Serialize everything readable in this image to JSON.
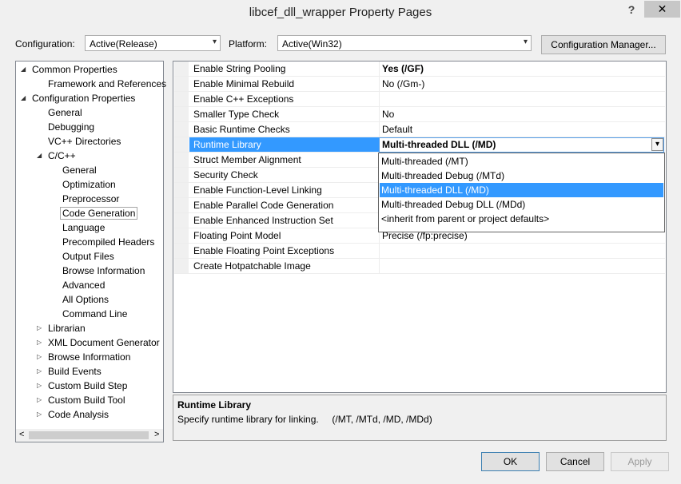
{
  "window": {
    "title": "libcef_dll_wrapper Property Pages",
    "help_glyph": "?",
    "close_glyph": "✕"
  },
  "toolbar": {
    "configuration_label": "Configuration:",
    "configuration_value": "Active(Release)",
    "platform_label": "Platform:",
    "platform_value": "Active(Win32)",
    "config_manager_label": "Configuration Manager..."
  },
  "tree": [
    {
      "label": "Common Properties",
      "expander": "◢"
    },
    {
      "label": "Framework and References",
      "expander": ""
    },
    {
      "label": "Configuration Properties",
      "expander": "◢"
    },
    {
      "label": "General",
      "expander": ""
    },
    {
      "label": "Debugging",
      "expander": ""
    },
    {
      "label": "VC++ Directories",
      "expander": ""
    },
    {
      "label": "C/C++",
      "expander": "◢"
    },
    {
      "label": "General",
      "expander": ""
    },
    {
      "label": "Optimization",
      "expander": ""
    },
    {
      "label": "Preprocessor",
      "expander": ""
    },
    {
      "label": "Code Generation",
      "expander": ""
    },
    {
      "label": "Language",
      "expander": ""
    },
    {
      "label": "Precompiled Headers",
      "expander": ""
    },
    {
      "label": "Output Files",
      "expander": ""
    },
    {
      "label": "Browse Information",
      "expander": ""
    },
    {
      "label": "Advanced",
      "expander": ""
    },
    {
      "label": "All Options",
      "expander": ""
    },
    {
      "label": "Command Line",
      "expander": ""
    },
    {
      "label": "Librarian",
      "expander": "▷"
    },
    {
      "label": "XML Document Generator",
      "expander": "▷"
    },
    {
      "label": "Browse Information",
      "expander": "▷"
    },
    {
      "label": "Build Events",
      "expander": "▷"
    },
    {
      "label": "Custom Build Step",
      "expander": "▷"
    },
    {
      "label": "Custom Build Tool",
      "expander": "▷"
    },
    {
      "label": "Code Analysis",
      "expander": "▷"
    }
  ],
  "properties": [
    {
      "name": "Enable String Pooling",
      "value": "Yes (/GF)"
    },
    {
      "name": "Enable Minimal Rebuild",
      "value": "No (/Gm-)"
    },
    {
      "name": "Enable C++ Exceptions",
      "value": ""
    },
    {
      "name": "Smaller Type Check",
      "value": "No"
    },
    {
      "name": "Basic Runtime Checks",
      "value": "Default"
    },
    {
      "name": "Runtime Library",
      "value": "Multi-threaded DLL (/MD)"
    },
    {
      "name": "Struct Member Alignment",
      "value": ""
    },
    {
      "name": "Security Check",
      "value": ""
    },
    {
      "name": "Enable Function-Level Linking",
      "value": ""
    },
    {
      "name": "Enable Parallel Code Generation",
      "value": ""
    },
    {
      "name": "Enable Enhanced Instruction Set",
      "value": ""
    },
    {
      "name": "Floating Point Model",
      "value": "Precise (/fp:precise)"
    },
    {
      "name": "Enable Floating Point Exceptions",
      "value": ""
    },
    {
      "name": "Create Hotpatchable Image",
      "value": ""
    }
  ],
  "dropdown": {
    "arrow_glyph": "▾",
    "options": [
      "Multi-threaded (/MT)",
      "Multi-threaded Debug (/MTd)",
      "Multi-threaded DLL (/MD)",
      "Multi-threaded Debug DLL (/MDd)",
      "<inherit from parent or project defaults>"
    ]
  },
  "description": {
    "title": "Runtime Library",
    "text": "Specify runtime library for linking.     (/MT, /MTd, /MD, /MDd)"
  },
  "scrollbar": {
    "left_glyph": "<",
    "right_glyph": ">"
  },
  "buttons": {
    "ok": "OK",
    "cancel": "Cancel",
    "apply": "Apply"
  },
  "colors": {
    "selection": "#3399ff",
    "panel_bg": "#ffffff",
    "window_bg": "#f0f0f0"
  }
}
